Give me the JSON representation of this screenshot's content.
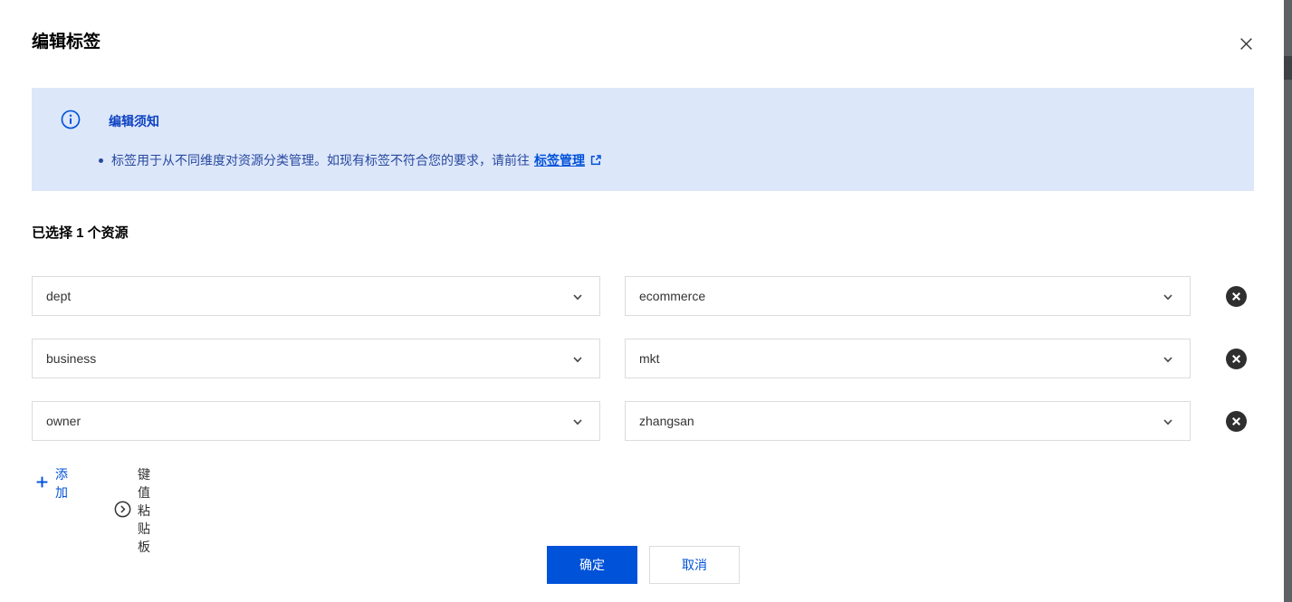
{
  "dialog": {
    "title": "编辑标签"
  },
  "notice": {
    "heading": "编辑须知",
    "body": "标签用于从不同维度对资源分类管理。如现有标签不符合您的要求，请前往",
    "link_label": "标签管理"
  },
  "summary": "已选择 1 个资源",
  "tag_rows": [
    {
      "key": "dept",
      "value": "ecommerce"
    },
    {
      "key": "business",
      "value": "mkt"
    },
    {
      "key": "owner",
      "value": "zhangsan"
    }
  ],
  "actions": {
    "add_label": "添加",
    "paste_label": "键值粘贴板"
  },
  "footer": {
    "confirm_label": "确定",
    "cancel_label": "取消"
  },
  "icons": {
    "info": "info-circle-icon",
    "external_link": "external-link-icon",
    "chevron_down": "chevron-down-icon",
    "remove": "circle-close-icon",
    "plus": "plus-icon",
    "paste": "chevron-right-circle-icon",
    "close": "close-icon"
  },
  "colors": {
    "primary": "#0052d9",
    "banner_bg": "#dde7fa",
    "banner_heading": "#0d42c2",
    "banner_text": "#27499f",
    "select_border": "#dcdcdc",
    "delete_fill": "#2f2f2f",
    "scrollbar": "#5d6064"
  }
}
